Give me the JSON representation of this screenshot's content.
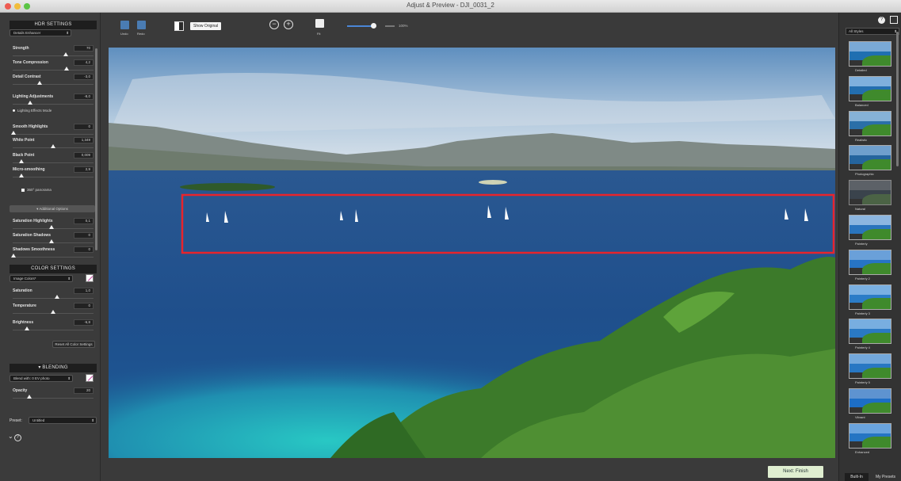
{
  "window": {
    "title": "Adjust & Preview - DJI_0031_2"
  },
  "hdr_settings": {
    "header": "HDR SETTINGS",
    "preset_select": "Details Enhancer",
    "params": [
      {
        "label": "Strength",
        "value": "70"
      },
      {
        "label": "Tone Compression",
        "value": "4,2"
      },
      {
        "label": "Detail Contrast",
        "value": "-3,0"
      },
      {
        "label": "Lighting Adjustments",
        "value": "-8,0"
      },
      {
        "label": "Smooth Highlights",
        "value": "0"
      },
      {
        "label": "White Point",
        "value": "1,349"
      },
      {
        "label": "Black Point",
        "value": "0,009"
      },
      {
        "label": "Micro-smoothing",
        "value": "2,9"
      },
      {
        "label": "Saturation Highlights",
        "value": "0,1"
      },
      {
        "label": "Saturation Shadows",
        "value": "0"
      },
      {
        "label": "Shadows Smoothness",
        "value": "0"
      }
    ],
    "lighting_effects": "Lighting Effects Mode",
    "panorama": "360° panorama",
    "additional": "Additional Options"
  },
  "color_settings": {
    "header": "COLOR SETTINGS",
    "select": "Image Colors*",
    "params": [
      {
        "label": "Saturation",
        "value": "1,0"
      },
      {
        "label": "Temperature",
        "value": "0"
      },
      {
        "label": "Brightness",
        "value": "-6,8"
      }
    ],
    "reset_button": "Reset All Color Settings"
  },
  "blending": {
    "header": "BLENDING",
    "select": "Blend with: 0 EV photo",
    "opacity_label": "Opacity",
    "opacity_value": "20"
  },
  "preset": {
    "label": "Preset:",
    "value": "Untitled"
  },
  "toolbar": {
    "undo": "Undo",
    "redo": "Redo",
    "show_original": "Show Original",
    "fit": "Fit",
    "zoom_value": "100%",
    "zoom_level": 0.55
  },
  "next_button": "Next: Finish",
  "styles_panel": {
    "filter": "All Styles",
    "items": [
      "Detailed",
      "Balanced",
      "Realistic",
      "Photographic",
      "Natural",
      "Painterly",
      "Painterly 2",
      "Painterly 3",
      "Painterly 4",
      "Painterly 5",
      "Vibrant",
      "Enhanced"
    ],
    "tabs": [
      "Built-In",
      "My Presets"
    ]
  },
  "colors": {
    "highlight_box": "#e8242c",
    "accent_blue": "#4a86d6",
    "next_button_bg": "#dfeed0"
  }
}
